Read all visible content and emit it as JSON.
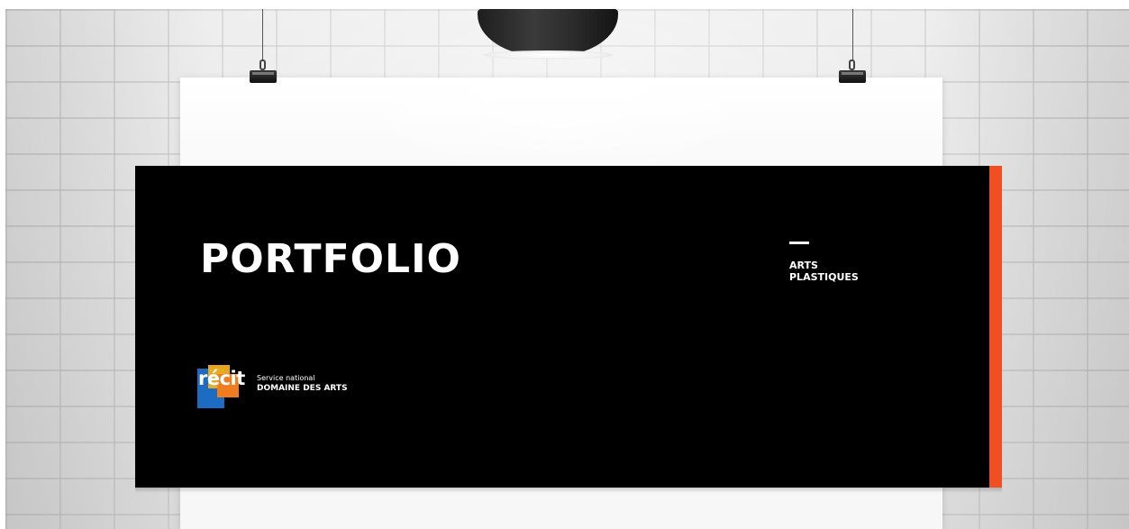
{
  "poster": {
    "title": "PORTFOLIO",
    "subject_line_1": "ARTS",
    "subject_line_2": "PLASTIQUES",
    "accent_color": "#f04e23",
    "banner_color": "#000000"
  },
  "logo": {
    "wordmark": "récit",
    "line_1": "Service national",
    "line_2": "DOMAINE DES ARTS",
    "colors": [
      "#1c6cc4",
      "#f2b01d",
      "#f07c1e"
    ]
  },
  "scene": {
    "objects": [
      "brick-wall",
      "pendant-lamp",
      "paper-sheet",
      "binder-clip",
      "binder-clip"
    ]
  }
}
